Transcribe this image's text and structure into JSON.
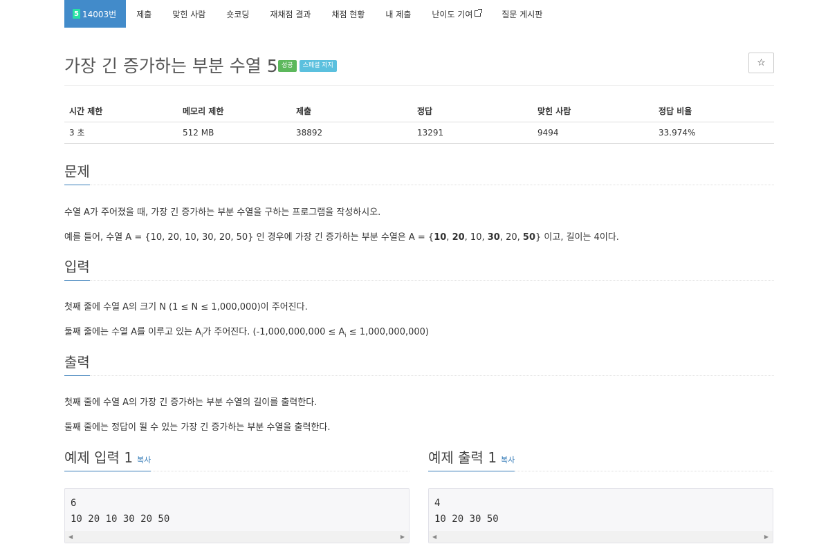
{
  "nav": {
    "tier_badge": "5",
    "problem_id": "14003번",
    "items": [
      "제출",
      "맞힌 사람",
      "숏코딩",
      "재채점 결과",
      "채점 현황",
      "내 제출",
      "난이도 기여",
      "질문 게시판"
    ]
  },
  "problem": {
    "title": "가장 긴 증가하는 부분 수열 5",
    "badge_success": "성공",
    "badge_special": "스페셜 저지",
    "star": "☆"
  },
  "stats": {
    "headers": [
      "시간 제한",
      "메모리 제한",
      "제출",
      "정답",
      "맞힌 사람",
      "정답 비율"
    ],
    "values": [
      "3 초",
      "512 MB",
      "38892",
      "13291",
      "9494",
      "33.974%"
    ]
  },
  "sections": {
    "description": "문제",
    "input": "입력",
    "output": "출력",
    "sample_input": "예제 입력 1",
    "sample_output": "예제 출력 1",
    "copy": "복사"
  },
  "description": {
    "p1": "수열 A가 주어졌을 때, 가장 긴 증가하는 부분 수열을 구하는 프로그램을 작성하시오.",
    "p2_prefix": "예를 들어, 수열 A = {10, 20, 10, 30, 20, 50} 인 경우에 가장 긴 증가하는 부분 수열은 A = {",
    "p2_b1": "10",
    "p2_sep1": ", ",
    "p2_b2": "20",
    "p2_mid": ", 10, ",
    "p2_b3": "30",
    "p2_mid2": ", 20, ",
    "p2_b4": "50",
    "p2_suffix": "} 이고, 길이는 4이다."
  },
  "input": {
    "p1": "첫째 줄에 수열 A의 크기 N (1 ≤ N ≤ 1,000,000)이 주어진다.",
    "p2_a": "둘째 줄에는 수열 A를 이루고 있는 A",
    "p2_sub": "i",
    "p2_b": "가 주어진다. (-1,000,000,000 ≤ A",
    "p2_sub2": "i",
    "p2_c": " ≤ 1,000,000,000)"
  },
  "output": {
    "p1": "첫째 줄에 수열 A의 가장 긴 증가하는 부분 수열의 길이를 출력한다.",
    "p2": "둘째 줄에는 정답이 될 수 있는 가장 긴 증가하는 부분 수열을 출력한다."
  },
  "samples": {
    "input": "6\n10 20 10 30 20 50",
    "output": "4\n10 20 30 50"
  }
}
